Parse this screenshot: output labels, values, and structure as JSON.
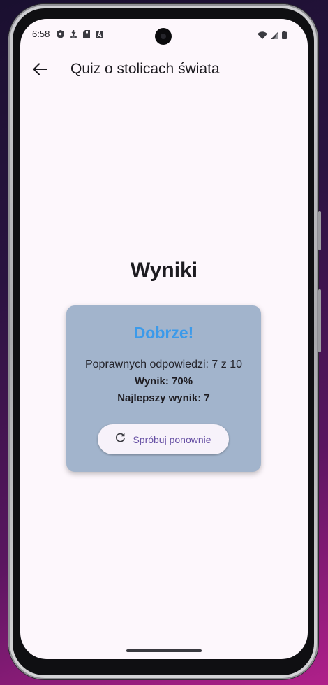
{
  "status_bar": {
    "time": "6:58",
    "left_icons": [
      "shield-icon",
      "usb-debug-icon",
      "sd-card-icon",
      "a-badge-icon"
    ],
    "right_icons": [
      "wifi-icon",
      "signal-icon",
      "battery-icon"
    ]
  },
  "app_bar": {
    "back_icon": "arrow-back-icon",
    "title": "Quiz o stolicach świata"
  },
  "results": {
    "heading": "Wyniki",
    "rating": "Dobrze!",
    "correct_answers": "Poprawnych odpowiedzi: 7 z 10",
    "score": "Wynik: 70%",
    "best_score": "Najlepszy wynik: 7",
    "retry_button": {
      "icon": "refresh-icon",
      "label": "Spróbuj ponownie"
    }
  },
  "colors": {
    "background": "#fdf7fc",
    "card": "#a2b4cc",
    "rating_text": "#3b9aea",
    "button_text": "#6750a4"
  }
}
